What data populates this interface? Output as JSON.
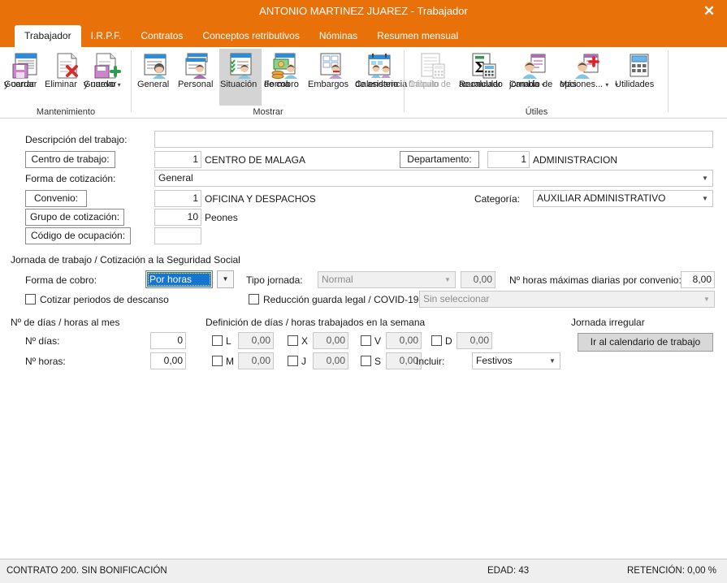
{
  "window": {
    "title": "ANTONIO MARTINEZ JUAREZ - Trabajador",
    "close_label": "✕",
    "accent_color": "#E8710A",
    "highlight_color": "#1675D1"
  },
  "tabs": [
    {
      "label": "Trabajador",
      "active": true
    },
    {
      "label": "I.R.P.F.",
      "active": false
    },
    {
      "label": "Contratos",
      "active": false
    },
    {
      "label": "Conceptos retributivos",
      "active": false
    },
    {
      "label": "Nóminas",
      "active": false
    },
    {
      "label": "Resumen mensual",
      "active": false
    }
  ],
  "ribbon": {
    "groups": [
      {
        "caption": "Mantenimiento",
        "buttons": [
          {
            "icon": "save-and-close-icon",
            "line1": "Guardar",
            "line2": "y cerrar",
            "caret": false,
            "selected": false,
            "disabled": false
          },
          {
            "icon": "delete-icon",
            "line1": "Eliminar",
            "line2": "",
            "caret": false,
            "selected": false,
            "disabled": false
          },
          {
            "icon": "save-and-new-icon",
            "line1": "Guardar",
            "line2": "y nuevo",
            "caret": true,
            "selected": false,
            "disabled": false
          }
        ]
      },
      {
        "caption": "Mostrar",
        "buttons": [
          {
            "icon": "general-icon",
            "line1": "General",
            "line2": "",
            "caret": false,
            "selected": false,
            "disabled": false
          },
          {
            "icon": "personal-icon",
            "line1": "Personal",
            "line2": "",
            "caret": false,
            "selected": false,
            "disabled": false
          },
          {
            "icon": "situacion-icon",
            "line1": "Situación",
            "line2": "",
            "caret": false,
            "selected": true,
            "disabled": false
          },
          {
            "icon": "forma-de-cobro-icon",
            "line1": "Forma",
            "line2": "de cobro",
            "caret": false,
            "selected": false,
            "disabled": false
          },
          {
            "icon": "embargos-icon",
            "line1": "Embargos",
            "line2": "",
            "caret": false,
            "selected": false,
            "disabled": false
          },
          {
            "icon": "calendario-asistencia-icon",
            "line1": "Calendario",
            "line2": "de asistencia",
            "caret": false,
            "selected": false,
            "disabled": false
          }
        ]
      },
      {
        "caption": "Útiles",
        "buttons": [
          {
            "icon": "calculo-finiquito-icon",
            "line1": "Cálculo de",
            "line2": "finiquito",
            "caret": false,
            "selected": false,
            "disabled": true
          },
          {
            "icon": "recalcular-acumulado-icon",
            "line1": "Recalcular",
            "line2": "acumulado",
            "caret": false,
            "selected": false,
            "disabled": false
          },
          {
            "icon": "cambio-jornada-icon",
            "line1": "Cambio de",
            "line2": "jornada",
            "caret": true,
            "selected": false,
            "disabled": false
          },
          {
            "icon": "mas-opciones-icon",
            "line1": "Más",
            "line2": "opciones...",
            "caret": true,
            "selected": false,
            "disabled": false
          },
          {
            "icon": "utilidades-icon",
            "line1": "Utilidades",
            "line2": "",
            "caret": true,
            "selected": false,
            "disabled": false
          }
        ]
      }
    ]
  },
  "form": {
    "descripcion_label": "Descripción del trabajo:",
    "descripcion_value": "",
    "centro_trabajo_button": "Centro de trabajo:",
    "centro_trabajo_code": "1",
    "centro_trabajo_name": "CENTRO DE MALAGA",
    "departamento_button": "Departamento:",
    "departamento_code": "1",
    "departamento_name": "ADMINISTRACION",
    "forma_cotizacion_label": "Forma de cotización:",
    "forma_cotizacion_value": "General",
    "convenio_button": "Convenio:",
    "convenio_code": "1",
    "convenio_name": "OFICINA Y DESPACHOS",
    "categoria_label": "Categoría:",
    "categoria_value": "AUXILIAR ADMINISTRATIVO",
    "grupo_cotizacion_button": "Grupo de cotización:",
    "grupo_cotizacion_code": "10",
    "grupo_cotizacion_name": "Peones",
    "codigo_ocupacion_button": "Código de ocupación:",
    "codigo_ocupacion_code": "",
    "jornada_section_title": "Jornada de trabajo / Cotización a la Seguridad Social",
    "forma_cobro_label": "Forma de cobro:",
    "forma_cobro_value": "Por horas",
    "cotizar_descanso_label": "Cotizar periodos de descanso",
    "cotizar_descanso_checked": false,
    "tipo_jornada_label": "Tipo jornada:",
    "tipo_jornada_value": "Normal",
    "tipo_jornada_pct": "0,00",
    "reduccion_label": "Reducción guarda legal / COVID-19",
    "reduccion_checked": false,
    "reduccion_value": "Sin seleccionar",
    "horas_max_label": "Nº horas máximas diarias por convenio:",
    "horas_max_value": "8,00",
    "dias_mes_section_title": "Nº de días / horas al mes",
    "n_dias_label": "Nº días:",
    "n_dias_value": "0",
    "n_horas_label": "Nº horas:",
    "n_horas_value": "0,00",
    "semana_section_title": "Definición de días / horas trabajados en la semana",
    "dias_semana": [
      {
        "key": "L",
        "value": "0,00",
        "checked": false
      },
      {
        "key": "M",
        "value": "0,00",
        "checked": false
      },
      {
        "key": "X",
        "value": "0,00",
        "checked": false
      },
      {
        "key": "J",
        "value": "0,00",
        "checked": false
      },
      {
        "key": "V",
        "value": "0,00",
        "checked": false
      },
      {
        "key": "S",
        "value": "0,00",
        "checked": false
      },
      {
        "key": "D",
        "value": "0,00",
        "checked": false
      }
    ],
    "incluir_label": "Incluir:",
    "incluir_value": "Festivos",
    "jornada_irregular_title": "Jornada irregular",
    "calendario_button": "Ir al calendario de trabajo"
  },
  "status": {
    "contrato": "CONTRATO 200.  SIN BONIFICACIÓN",
    "edad": "EDAD: 43",
    "retencion": "RETENCIÓN: 0,00 %"
  }
}
